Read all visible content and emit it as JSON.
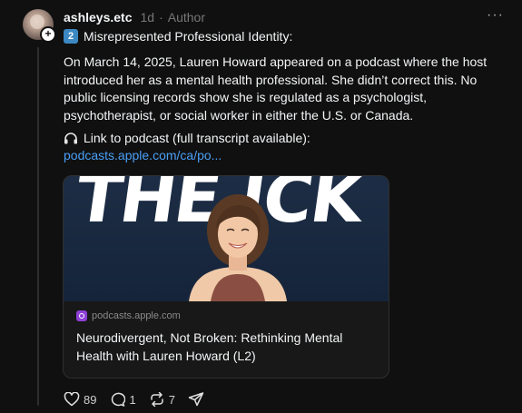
{
  "post": {
    "username": "ashleys.etc",
    "time": "1d",
    "separator": "·",
    "author_tag": "Author",
    "more_label": "···",
    "heading_number": "2",
    "heading_text": "Misrepresented Professional Identity:",
    "paragraph": "On March 14, 2025, Lauren Howard appeared on a podcast where the host introduced her as a mental health professional. She didn’t correct this. No public licensing records show she is regulated as a psychologist, psychotherapist, or social worker in either the U.S. or Canada.",
    "link_label": "Link to podcast (full transcript available):",
    "link_url": "podcasts.apple.com/ca/po..."
  },
  "card": {
    "image_text": "THE ICK",
    "source": "podcasts.apple.com",
    "title": "Neurodivergent, Not Broken: Rethinking Mental Health with Lauren Howard (L2)"
  },
  "actions": {
    "likes": "89",
    "comments": "1",
    "reposts": "7"
  },
  "icons": {
    "avatar_add": "plus-icon",
    "more": "more-horizontal-icon",
    "headphones": "headphones-icon",
    "podcast": "apple-podcasts-icon",
    "like": "heart-icon",
    "comment": "comment-icon",
    "repost": "repost-icon",
    "share": "send-icon"
  },
  "colors": {
    "background": "#101010",
    "link": "#4a9ff5",
    "badge": "#3b88c3",
    "podcast": "#8e3fd6"
  }
}
